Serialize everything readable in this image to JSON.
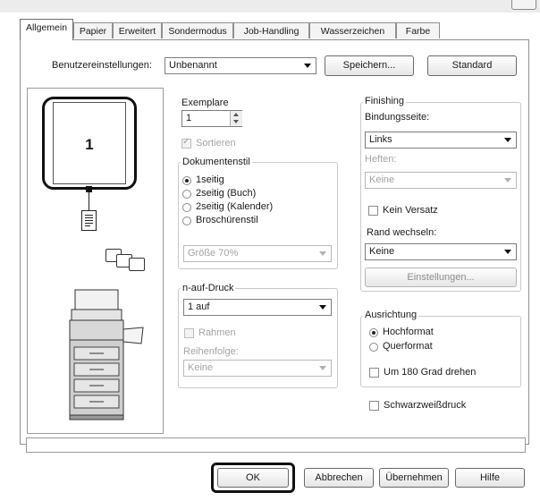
{
  "tabs": [
    "Allgemein",
    "Papier",
    "Erweitert",
    "Sondermodus",
    "Job-Handling",
    "Wasserzeichen",
    "Farbe"
  ],
  "user_settings": {
    "label": "Benutzereinstellungen:",
    "value": "Unbenannt",
    "save_button": "Speichern...",
    "default_button": "Standard"
  },
  "preview": {
    "page_number": "1"
  },
  "copies": {
    "label": "Exemplare",
    "value": "1"
  },
  "collate": {
    "label": "Sortieren",
    "checked": true,
    "enabled": false
  },
  "document_style": {
    "title": "Dokumentenstil",
    "options": [
      "1seitig",
      "2seitig (Buch)",
      "2seitig (Kalender)",
      "Broschürenstil"
    ],
    "selected": "1seitig",
    "size": "Größe 70%"
  },
  "n_up": {
    "title": "n-auf-Druck",
    "value": "1 auf",
    "border_label": "Rahmen",
    "order_label": "Reihenfolge:",
    "order_value": "Keine"
  },
  "finishing": {
    "title": "Finishing",
    "binding_label": "Bindungsseite:",
    "binding_value": "Links",
    "staple_label": "Heften:",
    "staple_value": "Keine",
    "no_offset_label": "Kein Versatz",
    "margin_label": "Rand wechseln:",
    "margin_value": "Keine",
    "settings_button": "Einstellungen..."
  },
  "orientation": {
    "title": "Ausrichtung",
    "options": [
      "Hochformat",
      "Querformat"
    ],
    "selected": "Hochformat",
    "rotate_label": "Um 180 Grad drehen"
  },
  "bw_print_label": "Schwarzweißdruck",
  "footer_buttons": {
    "ok": "OK",
    "cancel": "Abbrechen",
    "apply": "Übernehmen",
    "help": "Hilfe"
  }
}
